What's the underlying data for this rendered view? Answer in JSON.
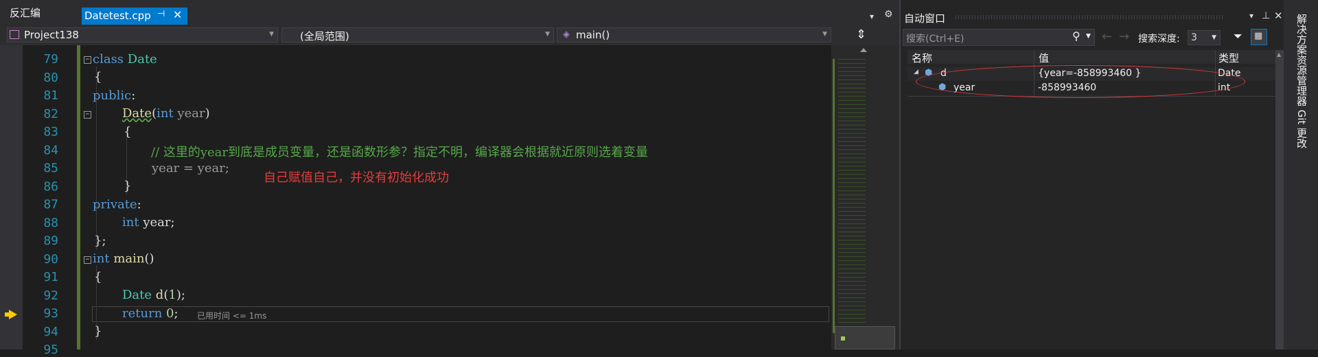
{
  "tabs": {
    "disasm": "反汇编",
    "active_file": "Datetest.cpp",
    "pin_glyph": "⊣",
    "close_glyph": "✕"
  },
  "topbar_icons": {
    "dropdown": "▾",
    "settings": "⚙"
  },
  "navbar": {
    "project": "Project138",
    "scope": "(全局范围)",
    "member": "main()",
    "split_glyph": "⇕"
  },
  "code_lines": [
    {
      "num": "79"
    },
    {
      "num": "80"
    },
    {
      "num": "81"
    },
    {
      "num": "82"
    },
    {
      "num": "83"
    },
    {
      "num": "84"
    },
    {
      "num": "85"
    },
    {
      "num": "86"
    },
    {
      "num": "87"
    },
    {
      "num": "88"
    },
    {
      "num": "89"
    },
    {
      "num": "90"
    },
    {
      "num": "91"
    },
    {
      "num": "92"
    },
    {
      "num": "93"
    },
    {
      "num": "94"
    },
    {
      "num": "95"
    }
  ],
  "code": {
    "l79_kw": "class",
    "l79_type": "Date",
    "l80": "{",
    "l81_kw": "public",
    "l81_p": ":",
    "l82_fn": "Date",
    "l82_p1": "(",
    "l82_kw": "int",
    "l82_param": "year",
    "l82_p2": ")",
    "l83": "{",
    "l84_comment": "// 这里的year到底是成员变量，还是函数形参？指定不明，编译器会根据就近原则选着变量",
    "l85": "year = year;",
    "l86": "}",
    "l87_kw": "private",
    "l87_p": ":",
    "l88_kw": "int",
    "l88_rest": "year;",
    "l89": "};",
    "l90_kw": "int",
    "l90_fn": "main",
    "l90_p": "()",
    "l91": "{",
    "l92_type": "Date",
    "l92_fn": "d",
    "l92_p1": "(",
    "l92_num": "1",
    "l92_p2": ");",
    "l93_kw": "return",
    "l93_num": "0",
    "l93_p": ";",
    "l94": "}"
  },
  "annotation": "自己赋值自己，并没有初始化成功",
  "perf_tip": "已用时间 <= 1ms",
  "autos": {
    "title": "自动窗口",
    "search_placeholder": "搜索(Ctrl+E)",
    "search_depth_label": "搜索深度:",
    "search_depth_value": "3",
    "col_name": "名称",
    "col_value": "值",
    "col_type": "类型",
    "rows": [
      {
        "name": "d",
        "value": "{year=-858993460 }",
        "type": "Date"
      },
      {
        "name": "year",
        "value": "-858993460",
        "type": "int"
      }
    ]
  },
  "sidebar": {
    "solution_explorer": "解决方案资源管理器",
    "git_changes": "Git 更改"
  },
  "colors": {
    "accent": "#007acc",
    "annotation": "#e83b3b",
    "ellipse": "#e23a3a"
  }
}
